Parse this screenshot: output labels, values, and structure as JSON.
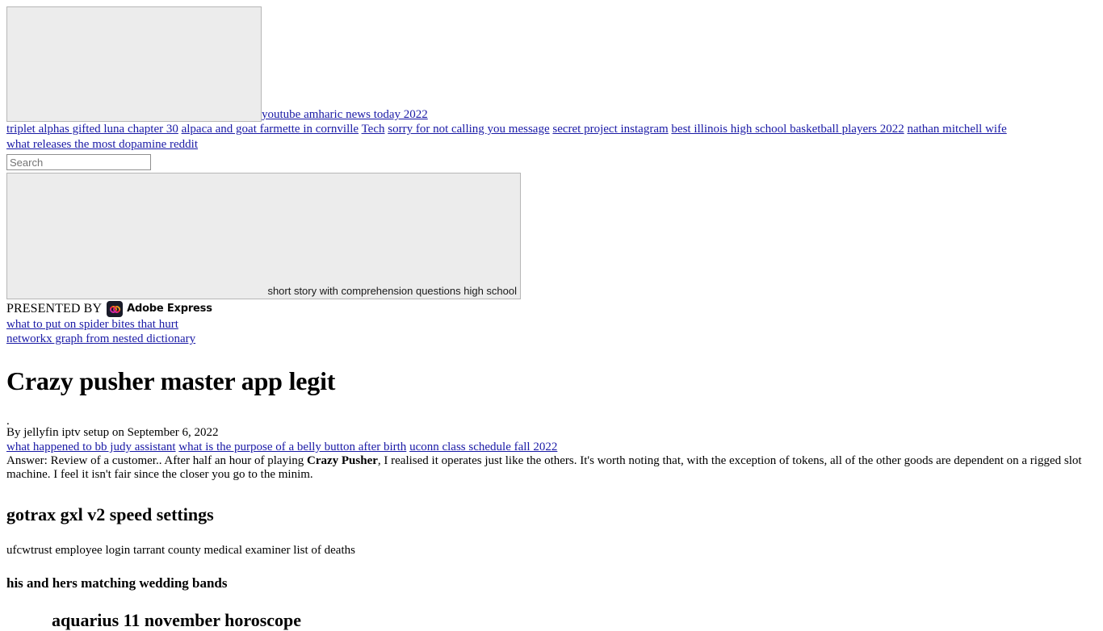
{
  "hero": {
    "image_alt": "",
    "caption_link": "youtube amharic news today 2022"
  },
  "nav": {
    "row1": [
      "triplet alphas gifted luna chapter 30",
      "alpaca and goat farmette in cornville",
      "Tech",
      "sorry for not calling you message",
      "secret project instagram",
      "best illinois high school basketball players 2022",
      "nathan mitchell wife"
    ],
    "row2": [
      "what releases the most dopamine reddit"
    ]
  },
  "search": {
    "placeholder": "Search",
    "value": ""
  },
  "secondary_image": {
    "alt_text": "short story with comprehension questions high school"
  },
  "presented": {
    "label": "PRESENTED BY",
    "brand": "Adobe Express",
    "logo_icon": "adobe-express-logo"
  },
  "sublinks": [
    "what to put on spider bites that hurt",
    "networkx graph from nested dictionary"
  ],
  "article": {
    "title": "Crazy pusher master app legit",
    "dot": ".",
    "byline": "By jellyfin iptv setup  on September 6, 2022",
    "byline_links": [
      "what happened to bb judy assistant",
      "what is the purpose of a belly button after birth",
      "uconn class schedule fall 2022"
    ],
    "body_part1": "Answer: Review of a customer.. After half an hour of playing ",
    "body_bold": "Crazy Pusher",
    "body_part2": ", I realised it operates just like the others. It's worth noting that, with the exception of tokens, all of the other goods are dependent on a rigged slot machine. I feel it isn't fair since the closer you go to the minim.",
    "heading_2": "gotrax gxl v2 speed settings",
    "paragraph_2": "ufcwtrust employee login tarrant county medical examiner list of deaths",
    "heading_3": "his and hers matching wedding bands",
    "heading_4": "aquarius 11 november horoscope"
  },
  "colors": {
    "link": "#1a1aa6",
    "placeholder_fill": "#ececec",
    "placeholder_border": "#b6b6b6",
    "adobe_logo_bg": "#191b29"
  }
}
